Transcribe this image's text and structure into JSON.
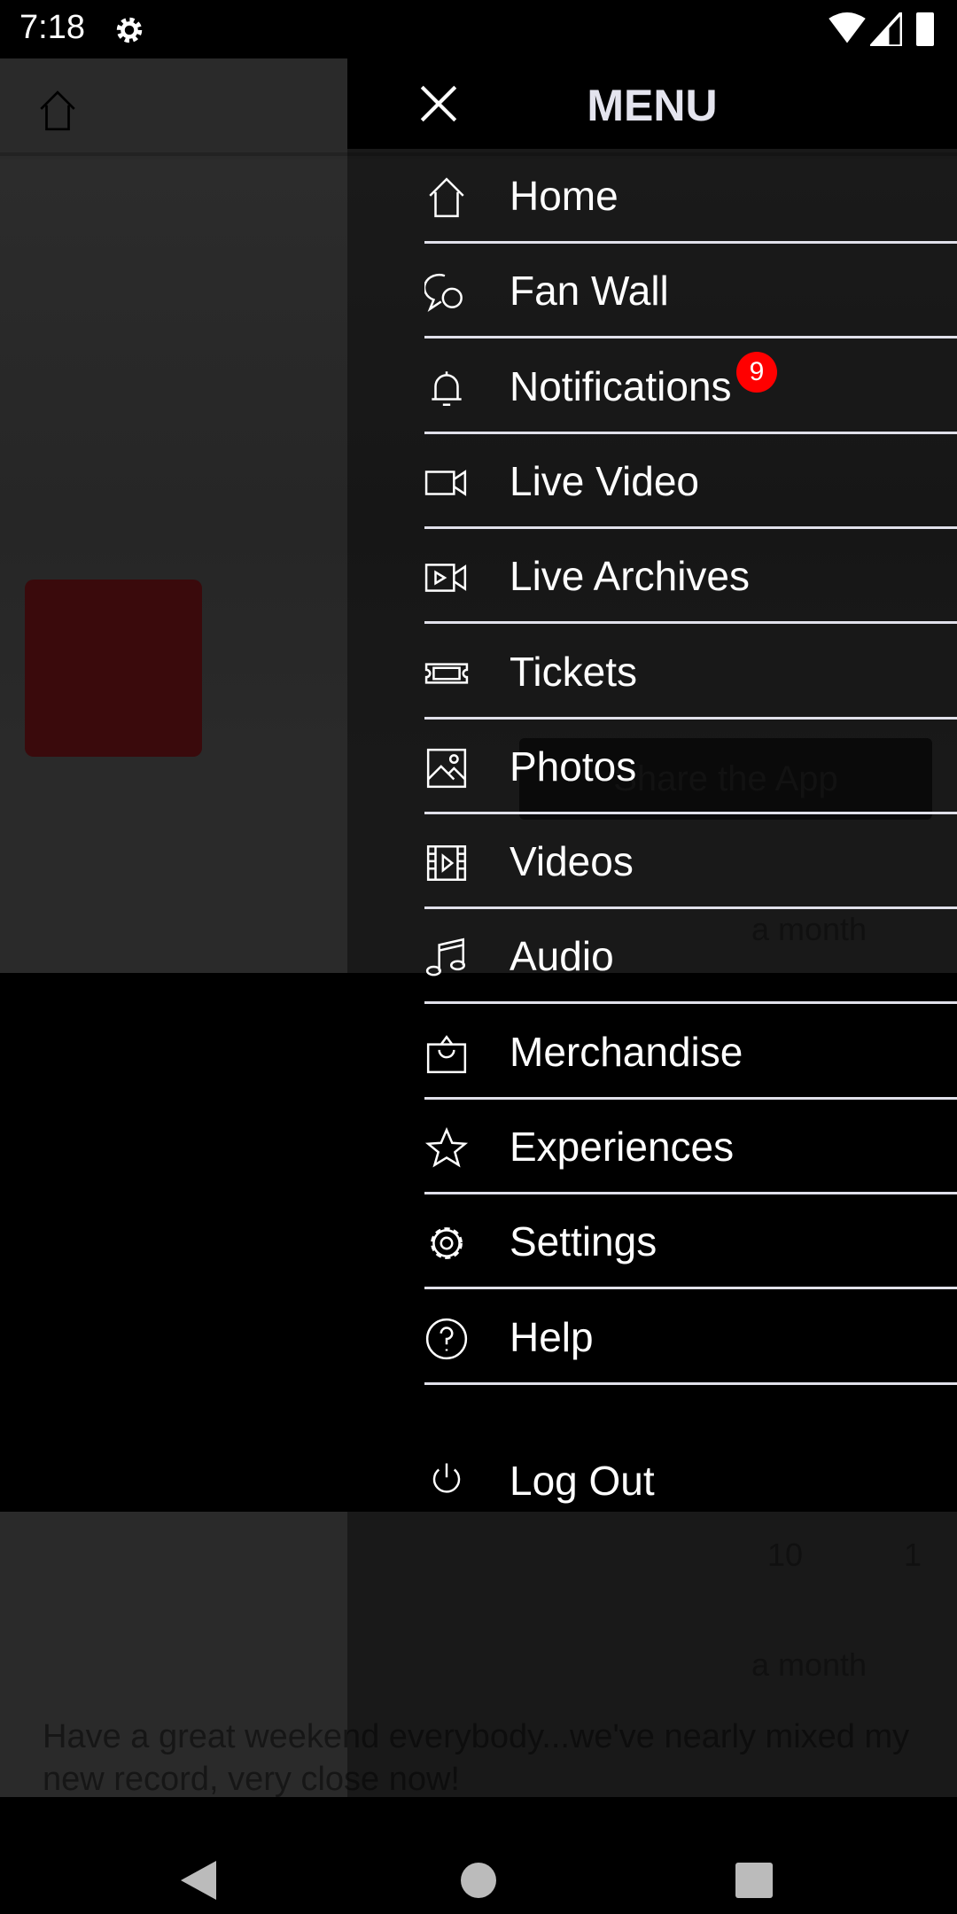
{
  "status_bar": {
    "time": "7:18"
  },
  "menu": {
    "title": "MENU",
    "items": [
      {
        "label": "Home",
        "icon": "home-icon"
      },
      {
        "label": "Fan Wall",
        "icon": "chat-bubbles-icon"
      },
      {
        "label": "Notifications",
        "icon": "bell-icon",
        "badge": "9"
      },
      {
        "label": "Live Video",
        "icon": "video-camera-icon"
      },
      {
        "label": "Live Archives",
        "icon": "video-archive-icon"
      },
      {
        "label": "Tickets",
        "icon": "ticket-icon"
      },
      {
        "label": "Photos",
        "icon": "image-icon"
      },
      {
        "label": "Videos",
        "icon": "film-icon"
      },
      {
        "label": "Audio",
        "icon": "music-note-icon"
      },
      {
        "label": "Merchandise",
        "icon": "shopping-bag-icon"
      },
      {
        "label": "Experiences",
        "icon": "star-icon"
      },
      {
        "label": "Settings",
        "icon": "gear-icon"
      },
      {
        "label": "Help",
        "icon": "help-circle-icon"
      }
    ],
    "logout": {
      "label": "Log Out",
      "icon": "power-icon"
    }
  },
  "background": {
    "share_button": "Share the App",
    "posts": [
      {
        "time": "a month"
      },
      {
        "likes": "10",
        "comments": "1"
      },
      {
        "time": "a month",
        "text": "Have a great weekend everybody...we've nearly mixed my new record, very close now!"
      }
    ]
  },
  "colors": {
    "badge": "#ff0000",
    "divider": "#e0e0ea",
    "panel": "#000000"
  }
}
